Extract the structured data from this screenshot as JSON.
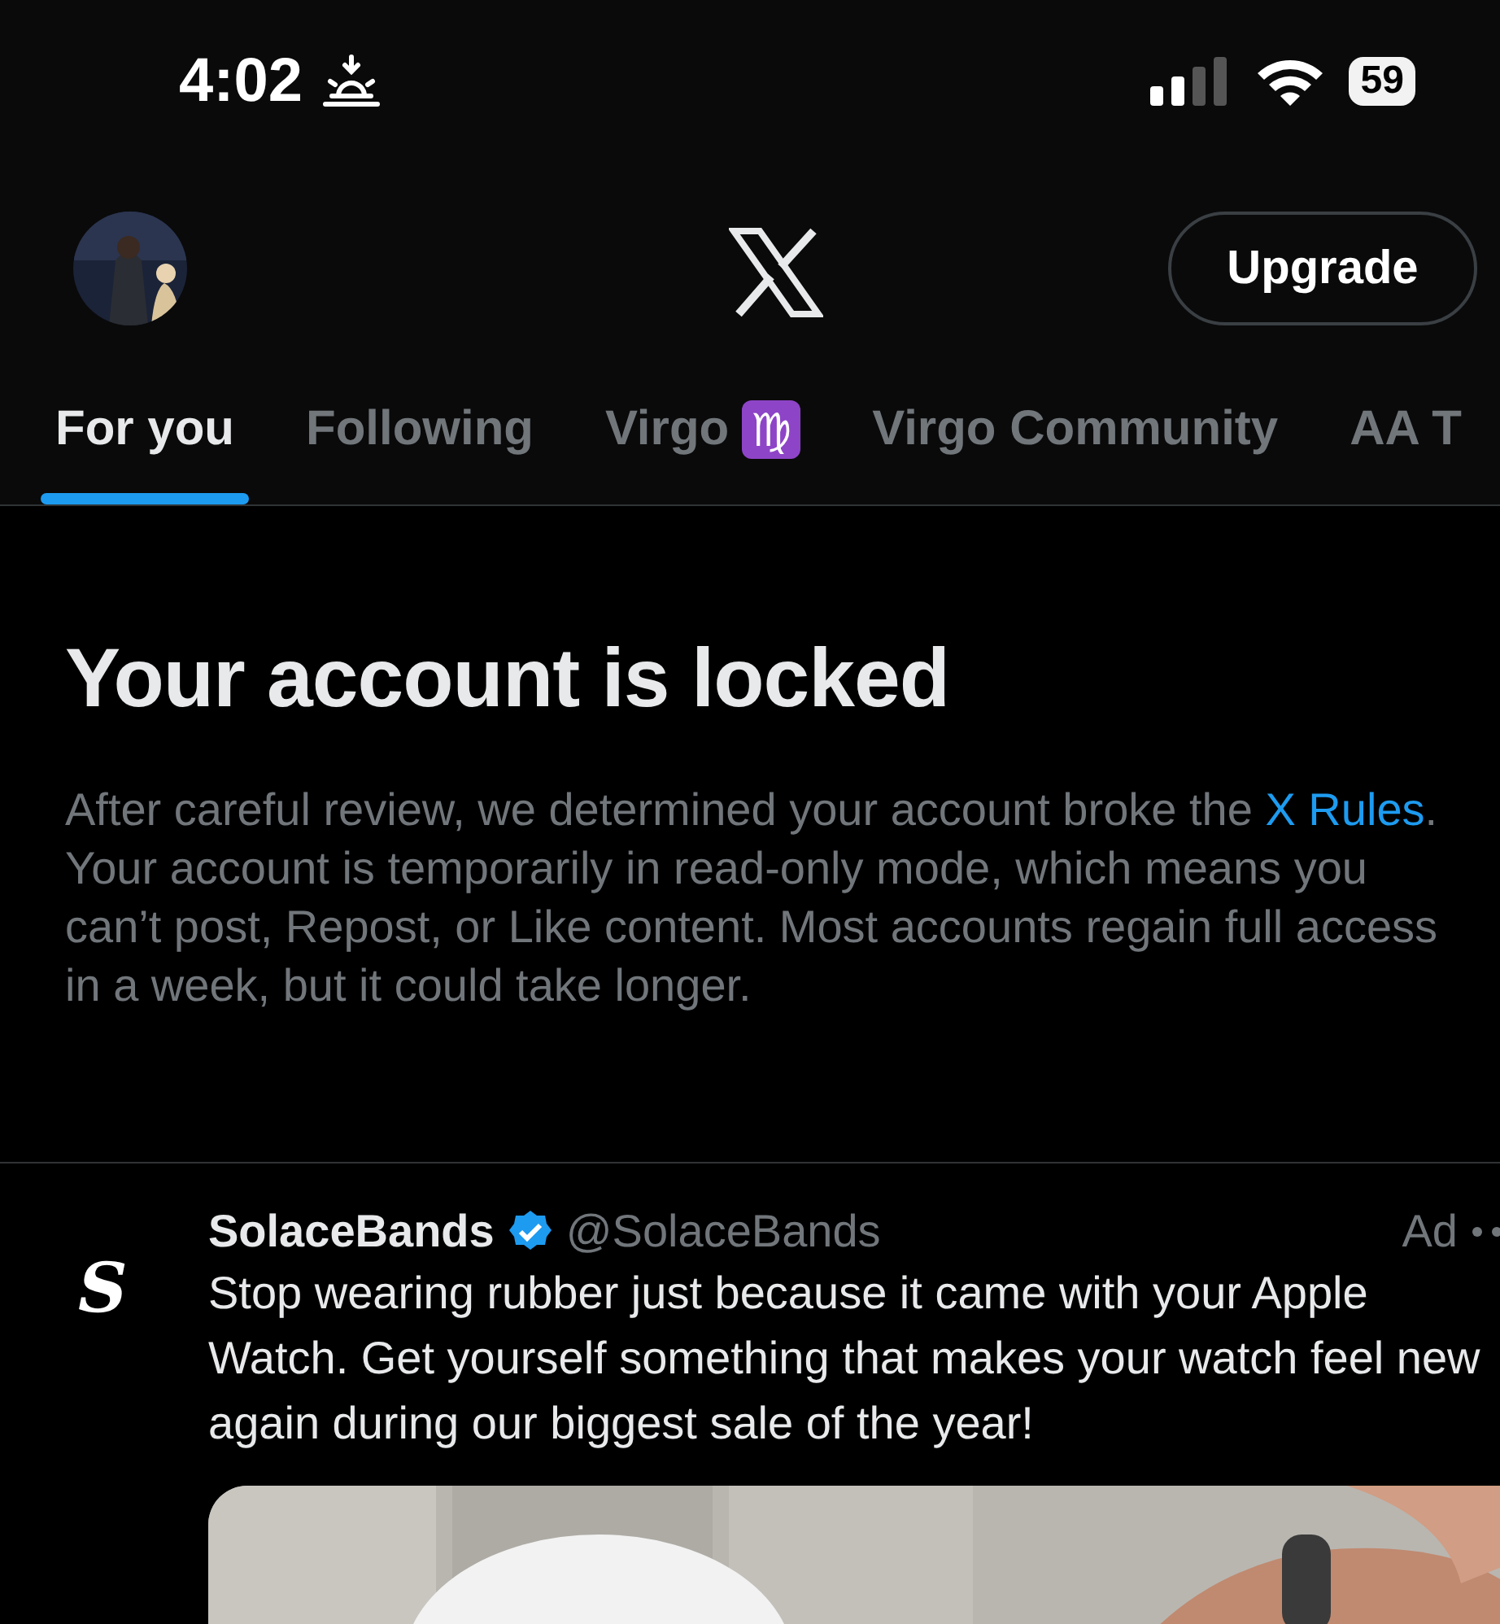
{
  "status_bar": {
    "time": "4:02",
    "battery": "59"
  },
  "header": {
    "upgrade_button": "Upgrade"
  },
  "tabs": [
    {
      "label": "For you",
      "selected": true
    },
    {
      "label": "Following",
      "selected": false
    },
    {
      "label": "Virgo",
      "emoji": "♍",
      "selected": false
    },
    {
      "label": "Virgo Community",
      "selected": false
    },
    {
      "label": "AA T",
      "selected": false
    }
  ],
  "notice": {
    "title": "Your account is locked",
    "before": "After careful review, we determined your account broke the ",
    "link": "X Rules",
    "after": ". Your account is temporarily in read-only mode, which means you can’t post, Repost, or Like content. Most accounts regain full access in a week, but it could take longer."
  },
  "ad": {
    "avatar_letter": "S",
    "name": "SolaceBands",
    "verified": true,
    "handle": "@SolaceBands",
    "label": "Ad",
    "text": "Stop wearing rubber just because it came with your Apple Watch. Get yourself something that makes your watch feel new again during our biggest sale of the year!"
  }
}
